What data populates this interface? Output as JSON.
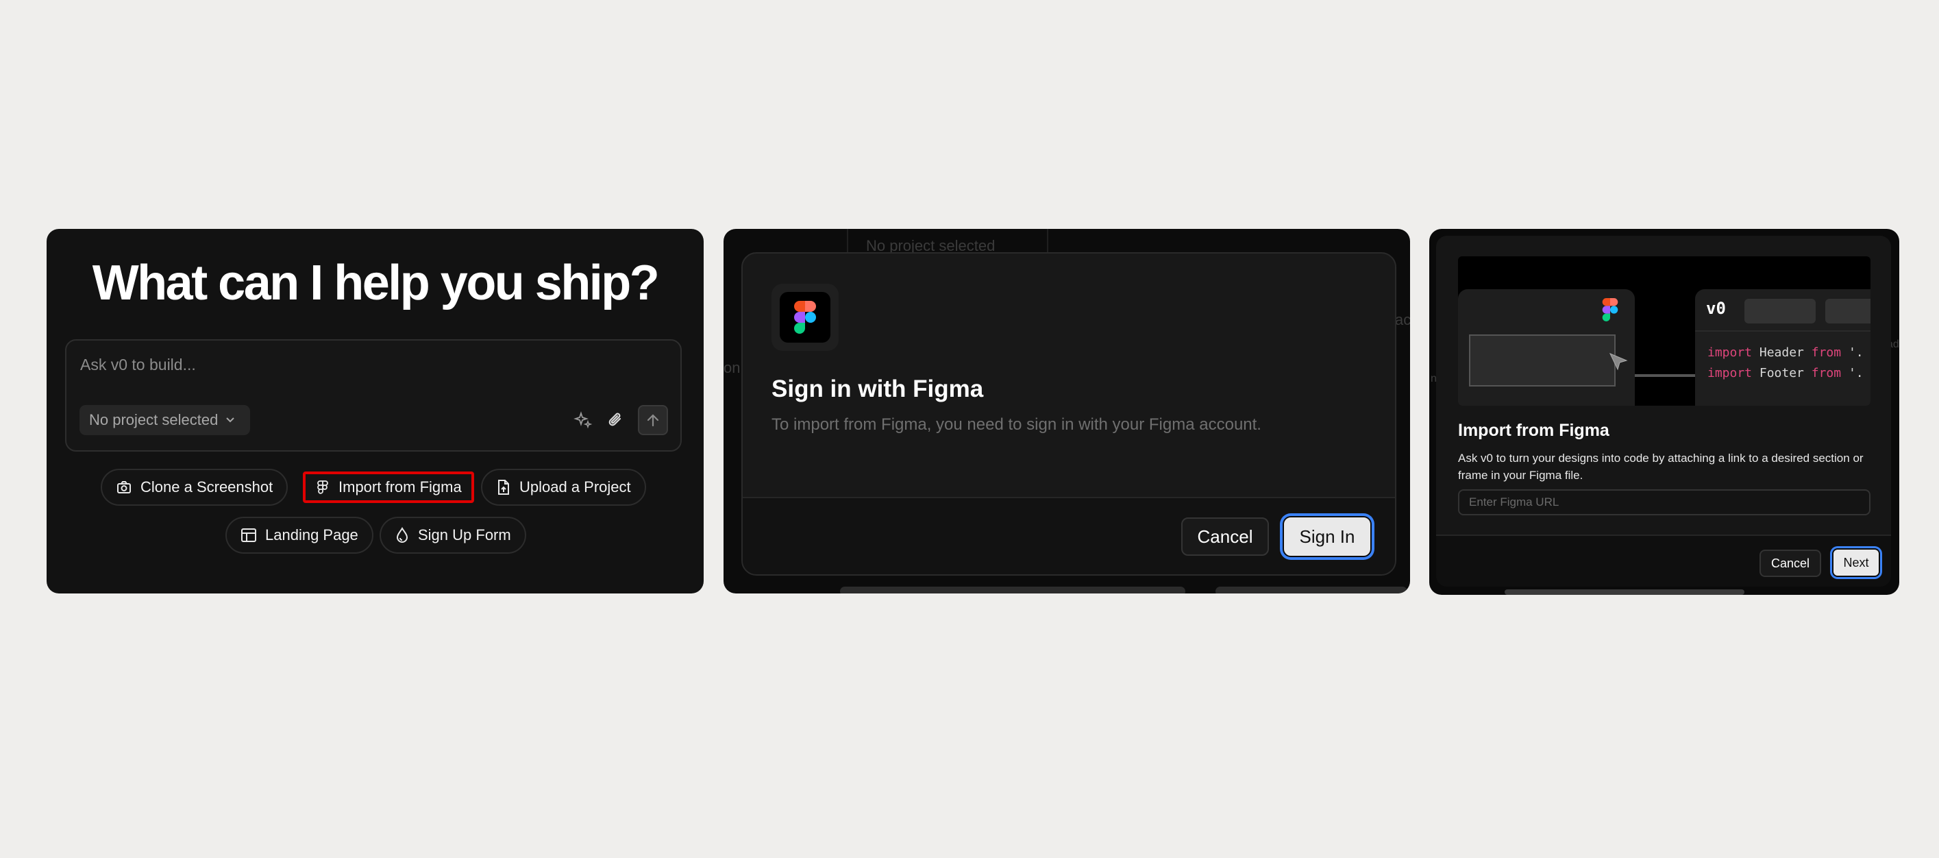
{
  "panel1": {
    "headline": "What can I help you ship?",
    "prompt_placeholder": "Ask v0 to build...",
    "project_selector": "No project selected",
    "chips": [
      {
        "label": "Clone a Screenshot",
        "icon": "camera-icon"
      },
      {
        "label": "Import from Figma",
        "icon": "figma-icon",
        "highlighted": true
      },
      {
        "label": "Upload a Project",
        "icon": "file-upload-icon"
      },
      {
        "label": "Landing Page",
        "icon": "layout-icon"
      },
      {
        "label": "Sign Up Form",
        "icon": "droplet-icon"
      }
    ],
    "highlight_color": "#e00000"
  },
  "panel2": {
    "background_project_selector": "No project selected",
    "background_fragments": [
      "on",
      "ac"
    ],
    "modal": {
      "title": "Sign in with Figma",
      "description": "To import from Figma, you need to sign in with your Figma account.",
      "cancel_label": "Cancel",
      "signin_label": "Sign In"
    },
    "focus_ring_color": "#3b82f6"
  },
  "panel3": {
    "hero": {
      "code_lines": [
        {
          "keyword": "import",
          "name": "Header",
          "from": "from",
          "tail": "'."
        },
        {
          "keyword": "import",
          "name": "Footer",
          "from": "from",
          "tail": "'."
        }
      ],
      "keyword_color": "#e0467c"
    },
    "title": "Import from Figma",
    "description": "Ask v0 to turn your designs into code by attaching a link to a desired section or frame in your Figma file.",
    "url_placeholder": "Enter Figma URL",
    "cancel_label": "Cancel",
    "next_label": "Next",
    "side_fragments": [
      "n",
      "ad"
    ]
  }
}
